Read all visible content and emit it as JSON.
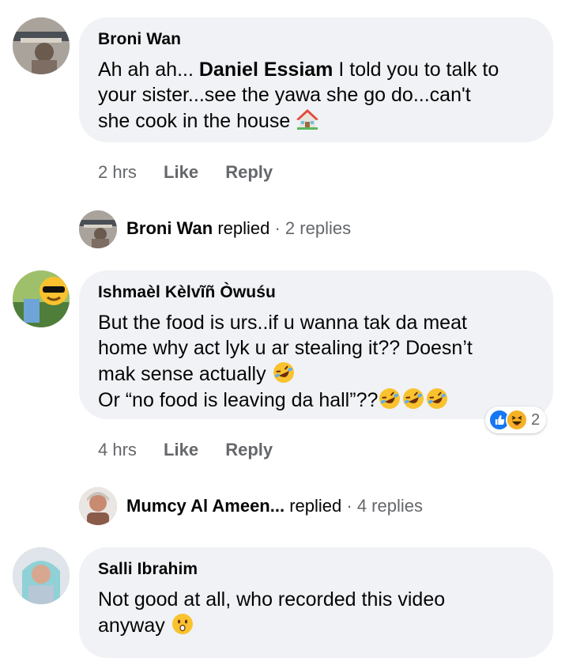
{
  "comments": [
    {
      "author": "Broni Wan",
      "mention": "Daniel Essiam",
      "text_before": "Ah ah ah... ",
      "text_after": " I told you to talk to\nyour sister...see the yawa she go do...can't\nshe cook in the house",
      "time": "2 hrs",
      "like": "Like",
      "reply": "Reply",
      "reply_summary": {
        "name": "Broni Wan",
        "verb": "replied",
        "count": "· 2 replies"
      }
    },
    {
      "author": "Ishmaèl Kèlvĩñ Òwuśu",
      "text": "But the food is urs..if u wanna tak da meat\nhome why act lyk u ar stealing it?? Doesn’t\nmak sense actually ",
      "text_line2": "Or “no food is leaving da hall”??",
      "time": "4 hrs",
      "like": "Like",
      "reply": "Reply",
      "reactions": {
        "icons": [
          "like-icon",
          "haha-icon"
        ],
        "count": "2"
      },
      "reply_summary": {
        "name": "Mumcy Al Ameen...",
        "verb": "replied",
        "count": "· 4 replies"
      }
    },
    {
      "author": "Salli Ibrahim",
      "text": "Not good at all, who recorded this video\nanyway "
    }
  ],
  "colors": {
    "bubble": "#f0f2f5",
    "meta": "#65676b",
    "like_blue": "#1877f2",
    "haha_yellow": "#f7b125"
  }
}
